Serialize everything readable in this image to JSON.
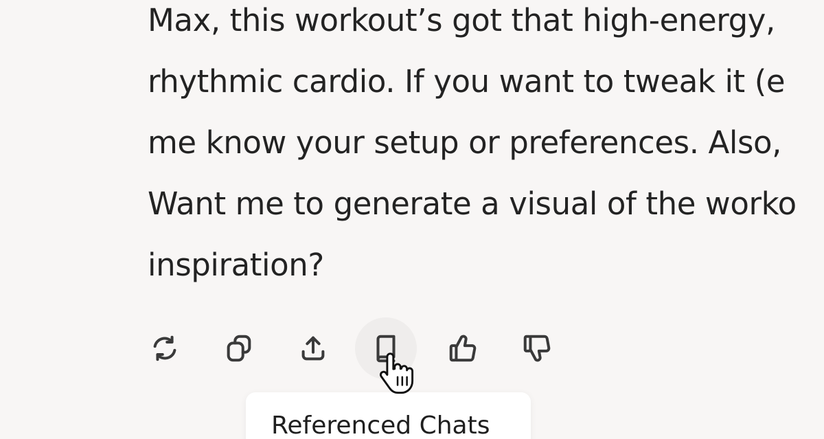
{
  "message": {
    "lines": [
      "Max, this workout’s got that high-energy,",
      "rhythmic cardio. If you want to tweak it (e",
      "me know your setup or preferences. Also,",
      "Want me to generate a visual of the worko",
      "inspiration?"
    ]
  },
  "toolbar": {
    "actions": [
      {
        "icon": "refresh-icon"
      },
      {
        "icon": "copy-icon"
      },
      {
        "icon": "share-icon"
      },
      {
        "icon": "book-icon"
      },
      {
        "icon": "thumbs-up-icon"
      },
      {
        "icon": "thumbs-down-icon"
      }
    ],
    "tooltip": "Referenced Chats"
  },
  "colors": {
    "background": "#f8f6f5",
    "text": "#232323",
    "icon": "#3a3a3a",
    "hover": "#efedec",
    "tooltip_bg": "#ffffff"
  }
}
